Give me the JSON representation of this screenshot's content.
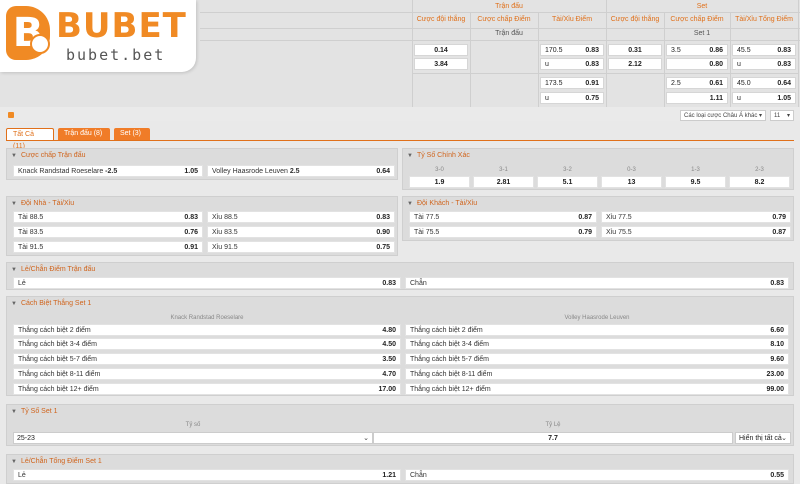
{
  "logo": {
    "text": "BUBET",
    "sub": "bubet.bet",
    "letter": "B"
  },
  "top": {
    "groups": [
      "Trận đấu",
      "Set"
    ],
    "columns": [
      "Cược đội thắng",
      "Cược chấp Điểm",
      "Tài/Xỉu Điểm",
      "Cược đội thắng",
      "Cược chấp Điểm",
      "Tài/Xỉu Tổng Điểm"
    ],
    "sublabels": [
      "Trận đấu",
      "Set 1"
    ],
    "rows": [
      {
        "ml": "0.14",
        "ou_line": "170.5",
        "ou_val": "0.83",
        "set_ml": "0.31",
        "set_hc_line": "3.5",
        "set_hc_val": "0.86",
        "set_ou_line": "45.5",
        "set_ou_val": "0.83"
      },
      {
        "ml": "3.84",
        "ou_line": "u",
        "ou_val": "0.83",
        "set_ml": "2.12",
        "set_hc_line": "",
        "set_hc_val": "0.80",
        "set_ou_line": "u",
        "set_ou_val": "0.83"
      },
      {
        "ml": "",
        "ou_line": "173.5",
        "ou_val": "0.91",
        "set_ml": "",
        "set_hc_line": "2.5",
        "set_hc_val": "0.61",
        "set_ou_line": "45.0",
        "set_ou_val": "0.64"
      },
      {
        "ml": "",
        "ou_line": "u",
        "ou_val": "0.75",
        "set_ml": "",
        "set_hc_line": "",
        "set_hc_val": "1.11",
        "set_ou_line": "u",
        "set_ou_val": "1.05"
      }
    ],
    "filter_select": "Các loại cược Châu Á khác",
    "count_select": "11"
  },
  "tabs": [
    {
      "label": "Tất Cả (11)"
    },
    {
      "label": "Trận đấu (8)"
    },
    {
      "label": "Set (3)"
    }
  ],
  "handicap": {
    "title": "Cược chấp Trận đấu",
    "home": "Knack Randstad Roeselare",
    "home_line": "-2.5",
    "home_odd": "1.05",
    "away": "Volley Haasrode Leuven",
    "away_line": "2.5",
    "away_odd": "0.64"
  },
  "correct_score": {
    "title": "Tỷ Số Chính Xác",
    "scores": [
      "3-0",
      "3-1",
      "3-2",
      "0-3",
      "1-3",
      "2-3"
    ],
    "odds": [
      "1.9",
      "2.81",
      "5.1",
      "13",
      "9.5",
      "8.2"
    ]
  },
  "home_ou": {
    "title": "Đội Nhà - Tài/Xỉu",
    "rows": [
      {
        "over": "Tài",
        "over_line": "88.5",
        "over_odd": "0.83",
        "under": "Xỉu",
        "under_line": "88.5",
        "under_odd": "0.83"
      },
      {
        "over": "Tài",
        "over_line": "83.5",
        "over_odd": "0.76",
        "under": "Xỉu",
        "under_line": "83.5",
        "under_odd": "0.90"
      },
      {
        "over": "Tài",
        "over_line": "91.5",
        "over_odd": "0.91",
        "under": "Xỉu",
        "under_line": "91.5",
        "under_odd": "0.75"
      }
    ]
  },
  "away_ou": {
    "title": "Đội Khách - Tài/Xỉu",
    "rows": [
      {
        "over": "Tài",
        "over_line": "77.5",
        "over_odd": "0.87",
        "under": "Xỉu",
        "under_line": "77.5",
        "under_odd": "0.79"
      },
      {
        "over": "Tài",
        "over_line": "75.5",
        "over_odd": "0.79",
        "under": "Xỉu",
        "under_line": "75.5",
        "under_odd": "0.87"
      }
    ]
  },
  "odd_even": {
    "title": "Lẻ/Chẵn Điểm Trận đấu",
    "odd_label": "Lẻ",
    "odd_val": "0.83",
    "even_label": "Chẵn",
    "even_val": "0.83"
  },
  "margin": {
    "title": "Cách Biệt Thắng Set 1",
    "home_team": "Knack Randstad Roeselare",
    "away_team": "Volley Haasrode Leuven",
    "rows": [
      {
        "label": "Thắng cách biệt 2 điểm",
        "home": "4.80",
        "away": "6.60"
      },
      {
        "label": "Thắng cách biệt 3-4 điểm",
        "home": "4.50",
        "away": "8.10"
      },
      {
        "label": "Thắng cách biệt 5-7 điểm",
        "home": "3.50",
        "away": "9.60"
      },
      {
        "label": "Thắng cách biệt 8-11 điểm",
        "home": "4.70",
        "away": "23.00"
      },
      {
        "label": "Thắng cách biệt 12+ điểm",
        "home": "17.00",
        "away": "99.00"
      }
    ]
  },
  "set_score": {
    "title": "Tỷ Số Set 1",
    "col_score": "Tỷ số",
    "col_ratio": "Tỷ Lệ",
    "score_value": "25-23",
    "ratio_value": "7.7",
    "show_select": "Hiển thị tất cả"
  },
  "set_odd_even": {
    "title": "Lẻ/Chẵn Tổng Điểm Set 1",
    "odd_label": "Lẻ",
    "odd_val": "1.21",
    "even_label": "Chẵn",
    "even_val": "0.55"
  }
}
